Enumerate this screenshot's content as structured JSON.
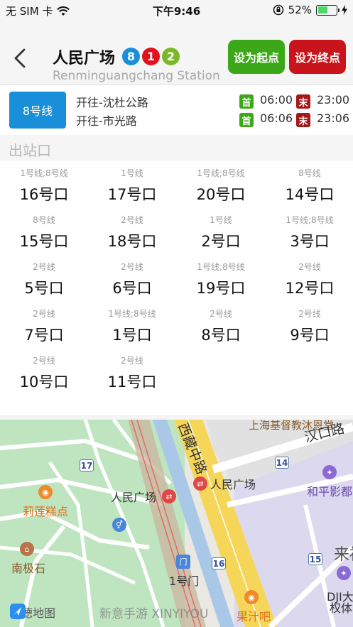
{
  "status_bar": {
    "carrier": "无 SIM 卡",
    "time": "下午9:46",
    "battery": "52%",
    "battery_fraction": 0.52
  },
  "header": {
    "station_name": "人民广场",
    "station_name_en": "Renminguangchang Station",
    "lines": [
      {
        "label": "8",
        "color": "#1a8fd9"
      },
      {
        "label": "1",
        "color": "#e0101e"
      },
      {
        "label": "2",
        "color": "#7ab829"
      }
    ],
    "set_start_label": "设为起点",
    "set_end_label": "设为终点"
  },
  "line_info": {
    "line_label": "8号线",
    "directions": [
      {
        "label": "开往-沈杜公路",
        "first_tag": "首",
        "first_time": "06:00",
        "last_tag": "末",
        "last_time": "23:00"
      },
      {
        "label": "开往-市光路",
        "first_tag": "首",
        "first_time": "06:06",
        "last_tag": "末",
        "last_time": "23:06"
      }
    ]
  },
  "exits": {
    "title": "出站口",
    "items": [
      {
        "lines": "1号线;8号线",
        "name": "16号口"
      },
      {
        "lines": "1号线",
        "name": "17号口"
      },
      {
        "lines": "1号线;8号线",
        "name": "20号口"
      },
      {
        "lines": "8号线",
        "name": "14号口"
      },
      {
        "lines": "8号线",
        "name": "15号口"
      },
      {
        "lines": "2号线",
        "name": "18号口"
      },
      {
        "lines": "1号线",
        "name": "2号口"
      },
      {
        "lines": "1号线;8号线",
        "name": "3号口"
      },
      {
        "lines": "2号线",
        "name": "5号口"
      },
      {
        "lines": "2号线",
        "name": "6号口"
      },
      {
        "lines": "1号线;8号线",
        "name": "19号口"
      },
      {
        "lines": "2号线",
        "name": "12号口"
      },
      {
        "lines": "2号线",
        "name": "7号口"
      },
      {
        "lines": "1号线;8号线",
        "name": "1号口"
      },
      {
        "lines": "2号线",
        "name": "8号口"
      },
      {
        "lines": "2号线",
        "name": "9号口"
      },
      {
        "lines": "2号线",
        "name": "10号口"
      },
      {
        "lines": "2号线",
        "name": "11号口"
      }
    ]
  },
  "map": {
    "labels": {
      "church": "上海基督教沐恩堂",
      "road_hankou": "汉口路",
      "road_xizang": "西藏中路",
      "station1": "人民广场",
      "station2": "人民广场",
      "heping": "和平影都",
      "lailai": "来福",
      "liliangao": "莉莲糕点",
      "nanjishi": "南极石",
      "exit1": "1号门",
      "dji": "DJI大疆",
      "dji2": "权体",
      "juice": "果汁吧",
      "logo": "高德地图",
      "watermark": "新意手游 XINYIYOU"
    },
    "road_badges": [
      "17",
      "14",
      "16",
      "15"
    ]
  }
}
